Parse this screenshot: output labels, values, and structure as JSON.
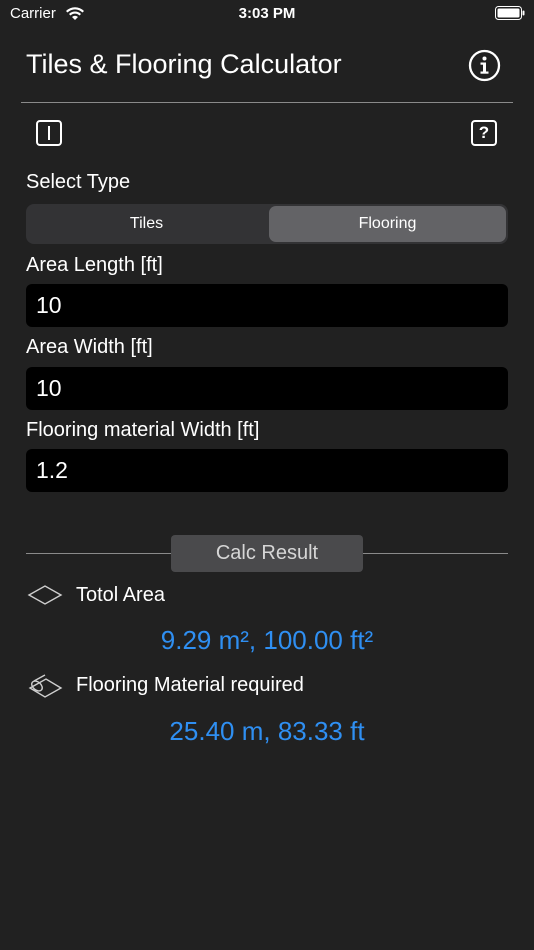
{
  "status": {
    "carrier": "Carrier",
    "time": "3:03 PM"
  },
  "header": {
    "title": "Tiles & Flooring Calculator"
  },
  "toolbar": {
    "help_label": "?"
  },
  "select_type": {
    "label": "Select Type",
    "options": [
      "Tiles",
      "Flooring"
    ],
    "selected": "Flooring"
  },
  "fields": {
    "length_label": "Area Length [ft]",
    "length_value": "10",
    "width_label": "Area Width [ft]",
    "width_value": "10",
    "material_label": "Flooring material Width [ft]",
    "material_value": "1.2"
  },
  "results": {
    "header": "Calc Result",
    "total_area_label": "Totol Area",
    "total_area_value": "9.29 m², 100.00 ft²",
    "material_label": "Flooring Material required",
    "material_value": "25.40 m, 83.33 ft"
  },
  "colors": {
    "background": "#212121",
    "accent": "#2f8ff2",
    "selected_segment": "#636366"
  }
}
